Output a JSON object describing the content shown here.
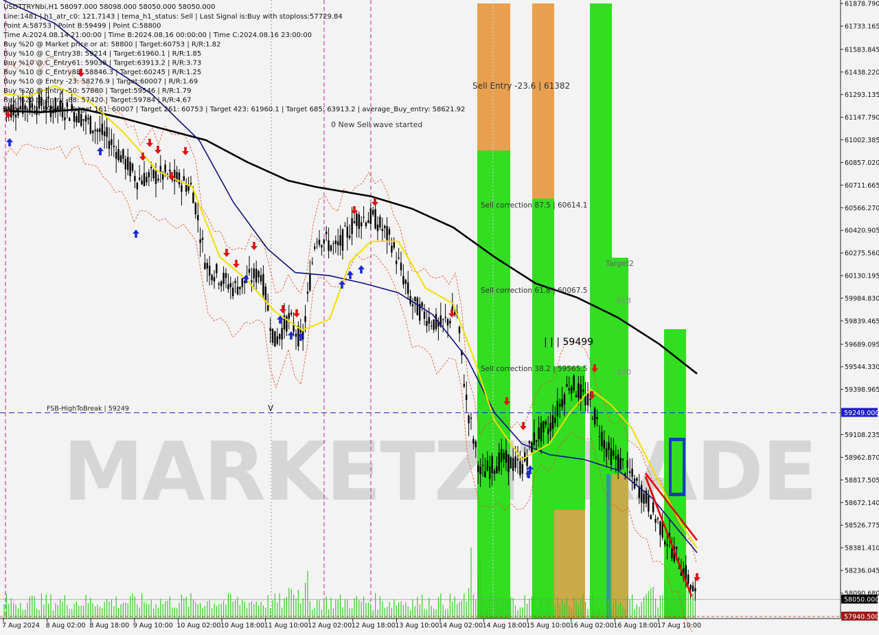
{
  "chart_data": {
    "type": "candlestick",
    "symbol_header": "USDTTRYNbi,H1  58097.000 58098.000 58050.000 58050.000",
    "info_lines": [
      "Line:1481  |  h1_atr_c0: 121.7143  |  tema_h1_status: Sell  |  Last Signal is:Buy with stoploss:57729.84",
      "Point A:58753  |  Point B:59499  |  Point C:58800",
      "Time A:2024.08.14 21:00:00  |  Time B:2024.08.16 00:00:00  |  Time C:2024.08.16 23:00:00",
      "Buy %20 @ Market price or at: 58800  |  Target:60753  |  R/R:1.82",
      "Buy %10 @ C_Entry38: 59214  |  Target:61960.1  |  R/R:1.85",
      "Buy %10 @ C_Entry61: 59038  |  Target:63913.2  |  R/R:3.73",
      "Buy %10 @ C_Entry88: 58846.3  |  Target:60245  |  R/R:1.25",
      "Buy %10 @ Entry -23: 58276.9  |  Target:60007  |  R/R:1.69",
      "Buy %20 @ Entry -50: 57880  |  Target:59546  |  R/R:1.79",
      "Buy %20 @ Entry -88: 57420  |  Target:59784  |  R/R:4.67",
      "Target100: 59546  |  Target 161: 60007  |  Target 261: 60753  |  Target 423: 61960.1  |  Target 685: 63913.2  |  average_Buy_entry: 58621.92"
    ],
    "y_ticks": [
      "61878.790",
      "61733.165",
      "61583.845",
      "61438.220",
      "61293.135",
      "61147.790",
      "61002.385",
      "60857.020",
      "60711.665",
      "60566.270",
      "60420.905",
      "60275.560",
      "60130.195",
      "59984.830",
      "59839.465",
      "59689.095",
      "59544.330",
      "59398.965",
      "59249.000",
      "59108.235",
      "58962.870",
      "58817.505",
      "58672.140",
      "58526.775",
      "58381.410",
      "58236.045",
      "58090.680",
      "58050.000",
      "57940.500"
    ],
    "x_ticks": [
      "7 Aug 2024",
      "8 Aug 02:00",
      "8 Aug 18:00",
      "9 Aug 10:00",
      "10 Aug 02:00",
      "10 Aug 18:00",
      "11 Aug 10:00",
      "12 Aug 02:00",
      "12 Aug 18:00",
      "13 Aug 10:00",
      "14 Aug 02:00",
      "14 Aug 18:00",
      "15 Aug 10:00",
      "16 Aug 02:00",
      "16 Aug 18:00",
      "17 Aug 10:00"
    ],
    "ylim": [
      57930,
      61890
    ],
    "current_price": "58050.000",
    "current_price_color": "#000000",
    "bottom_price": "57940.500",
    "bottom_price_color": "#a01818",
    "hline": {
      "value": 59249,
      "label": "FSB-HighToBreak  |  59249",
      "tag": "59249.000",
      "color": "#1f1fd0"
    },
    "annotations": {
      "new_sell_wave": "0 New Sell wave started",
      "sell_entry": "Sell Entry -23.6 | 61382",
      "sell_corr_875": "Sell correction 87.5 | 60614.1",
      "sell_corr_618": "Sell correction 61.8 | 60067.5",
      "sell_corr_382": "Sell correction 38.2 | 59565.5",
      "point_b": "| | | 59499",
      "target2": "Target2",
      "t618": "618",
      "t100": "100",
      "v_mark": "V"
    },
    "watermark": "MARKETZITRADE",
    "colors": {
      "green": "#33dd22",
      "orange": "#e8a050",
      "ma_black": "#000000",
      "ma_navy": "#101080",
      "ma_yellow": "#f0e000",
      "up_arrow": "#1a2ad0",
      "down_arrow": "#e01010"
    }
  }
}
